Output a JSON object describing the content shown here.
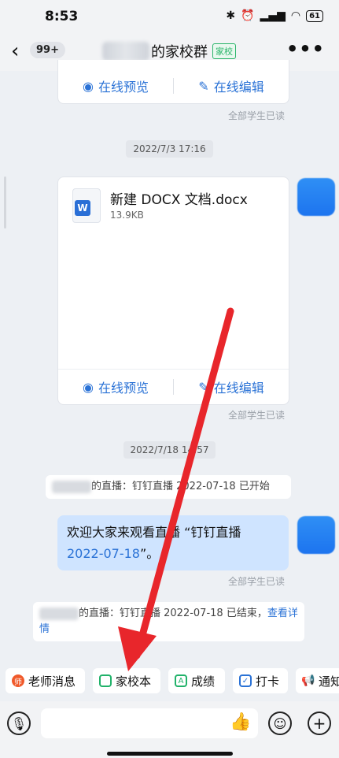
{
  "status_bar": {
    "time": "8:53",
    "battery": "61"
  },
  "header": {
    "unread_count": "99+",
    "group_name_suffix": "的家校群",
    "group_tag": "家校"
  },
  "messages": {
    "card1": {
      "preview": "在线预览",
      "edit": "在线编辑",
      "read_status": "全部学生已读"
    },
    "time1": "2022/7/3 17:16",
    "file_card": {
      "file_name": "新建 DOCX 文档.docx",
      "file_size": "13.9KB",
      "preview": "在线预览",
      "edit": "在线编辑",
      "read_status": "全部学生已读"
    },
    "time2": "2022/7/18 14:57",
    "live_start": "的直播：钉钉直播 2022-07-18 已开始",
    "welcome": {
      "text_before": "欢迎大家来观看直播 “钉钉直播 ",
      "link_text": "2022-07-18",
      "text_after": "”。",
      "read_status": "全部学生已读"
    },
    "live_end": {
      "text": "的直播：钉钉直播 2022-07-18 已结束，",
      "link": "查看详情"
    }
  },
  "quick_bar": [
    {
      "label": "老师消息",
      "icon": "teacher-icon",
      "color": "#f0592a"
    },
    {
      "label": "家校本",
      "icon": "notebook-icon",
      "color": "#21b26a"
    },
    {
      "label": "成绩",
      "icon": "grade-icon",
      "color": "#21b26a"
    },
    {
      "label": "打卡",
      "icon": "checkin-icon",
      "color": "#2a72d6"
    },
    {
      "label": "通知",
      "icon": "notice-icon",
      "color": "#f0592a"
    }
  ],
  "input_bar": {
    "placeholder": ""
  },
  "colors": {
    "accent": "#2a72d6",
    "arrow": "#e8262b"
  }
}
